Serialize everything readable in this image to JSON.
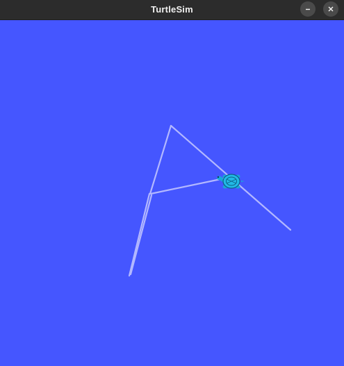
{
  "window": {
    "title": "TurtleSim",
    "buttons": [
      "minimize",
      "close"
    ]
  },
  "canvas": {
    "background_color": "#4556ff",
    "pen_color": "#b3b8ff",
    "turtle_icon": "turtle-icon"
  }
}
